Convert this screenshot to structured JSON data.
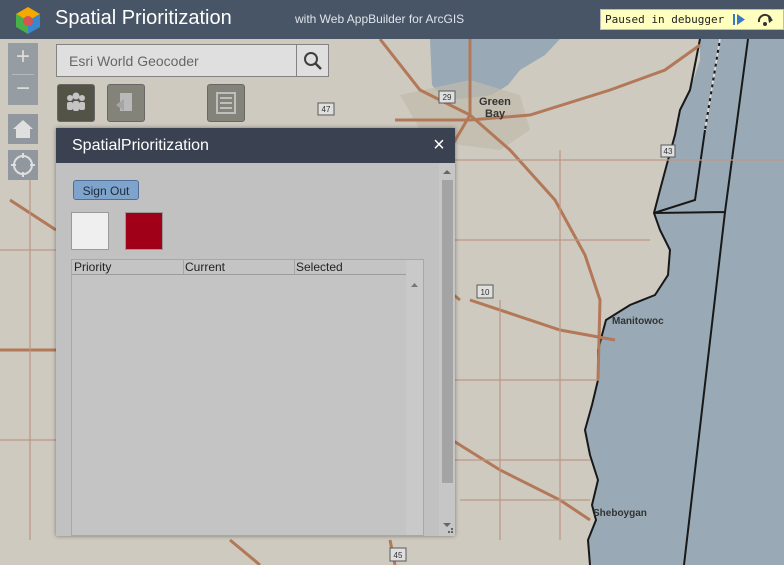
{
  "header": {
    "title": "Spatial Prioritization",
    "subtitle": "with Web AppBuilder for ArcGIS"
  },
  "debugger": {
    "message": "Paused in debugger"
  },
  "map": {
    "labels": {
      "green_bay_1": "Green",
      "green_bay_2": "Bay",
      "manitowoc": "Manitowoc",
      "sheboygan": "Sheboygan"
    },
    "shields": {
      "h29": "29",
      "h47": "47",
      "h43": "43",
      "h10": "10",
      "h45": "45"
    }
  },
  "controls": {
    "zoom_in": "+",
    "zoom_out": "−"
  },
  "search": {
    "placeholder": "Esri World Geocoder"
  },
  "panel": {
    "title": "SpatialPrioritization",
    "close": "×",
    "sign_out_label": "Sign Out",
    "swatch_colors": [
      "#efefef",
      "#a00018"
    ],
    "table": {
      "columns": [
        "Priority",
        "Current",
        "Selected"
      ],
      "rows": []
    }
  },
  "colors": {
    "header_bg": "#485566",
    "panel_header_bg": "#3a4150",
    "water": "#a6bccb",
    "land": "#e9e4d6",
    "road": "#c67b52"
  }
}
